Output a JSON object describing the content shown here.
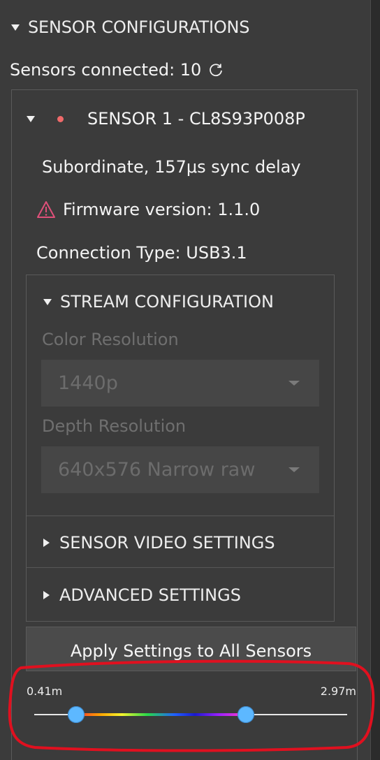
{
  "section": {
    "title": "SENSOR CONFIGURATIONS"
  },
  "sensors": {
    "connected_label": "Sensors connected: 10",
    "refresh_icon": "refresh-icon"
  },
  "sensor1": {
    "title": "SENSOR 1 - CL8S93P008P",
    "status_color": "#f06a6a",
    "sync_info": "Subordinate, 157μs sync delay",
    "firmware": "Firmware version: 1.1.0",
    "warning_icon": "warning-triangle-icon",
    "warning_color": "#e0507a",
    "connection": "Connection Type: USB3.1"
  },
  "stream": {
    "header": "STREAM CONFIGURATION",
    "color_label": "Color Resolution",
    "color_value": "1440p",
    "depth_label": "Depth Resolution",
    "depth_value": "640x576 Narrow raw"
  },
  "collapsed": {
    "video": "SENSOR VIDEO SETTINGS",
    "advanced": "ADVANCED SETTINGS"
  },
  "apply_button": "Apply Settings to All Sensors",
  "depth_range": {
    "min_label": "0.41m",
    "max_label": "2.97m",
    "handle_color": "#5db8ff"
  },
  "annotation": {
    "color": "#e0101f"
  }
}
